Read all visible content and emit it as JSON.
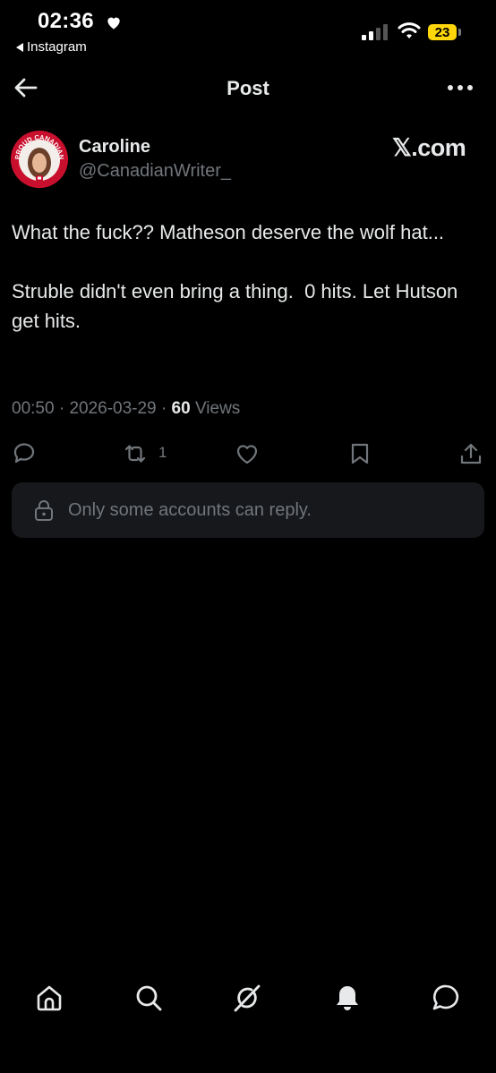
{
  "status_bar": {
    "time": "02:36",
    "back_app": "Instagram",
    "battery": "23",
    "battery_color": "#ffd60a"
  },
  "header": {
    "title": "Post",
    "back_icon": "arrow-left-icon",
    "more_icon": "more-horizontal-icon"
  },
  "post": {
    "author_name": "Caroline",
    "author_handle": "@CanadianWriter_",
    "avatar_badge": "PROUD CANADIAN",
    "source": "𝕏.com",
    "text": "What the fuck?? Matheson deserve the wolf hat...\n\nStruble didn't even bring a thing.  0 hits. Let Hutson get hits.",
    "time": "00:50",
    "date": "2026-03-29",
    "views_count": "60",
    "views_label": "Views",
    "repost_count": "1"
  },
  "reply_restriction": {
    "text": "Only some accounts can reply."
  },
  "bottom_nav": [
    "home-icon",
    "search-icon",
    "grok-icon",
    "notifications-icon",
    "messages-icon"
  ],
  "colors": {
    "background": "#000000",
    "text": "#e7e9ea",
    "muted": "#71767b",
    "card": "#16181c",
    "avatar_ring": "#c8102e"
  }
}
